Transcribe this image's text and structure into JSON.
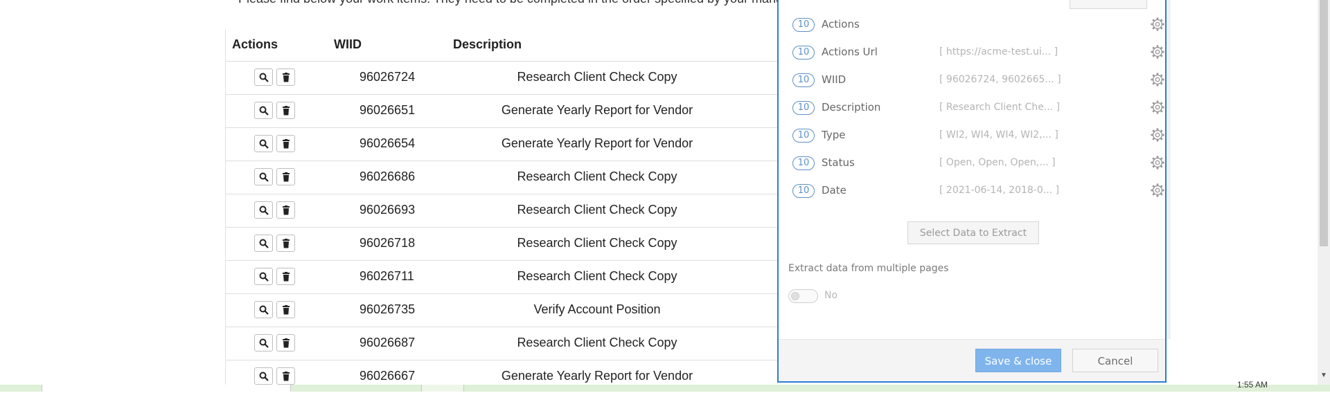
{
  "page": {
    "intro": "Please find below your work items. They need to be completed in the order specified by your manager.",
    "columns": {
      "actions": "Actions",
      "wiid": "WIID",
      "description": "Description"
    },
    "rows": [
      {
        "wiid": "96026724",
        "description": "Research Client Check Copy"
      },
      {
        "wiid": "96026651",
        "description": "Generate Yearly Report for Vendor"
      },
      {
        "wiid": "96026654",
        "description": "Generate Yearly Report for Vendor"
      },
      {
        "wiid": "96026686",
        "description": "Research Client Check Copy"
      },
      {
        "wiid": "96026693",
        "description": "Research Client Check Copy"
      },
      {
        "wiid": "96026718",
        "description": "Research Client Check Copy"
      },
      {
        "wiid": "96026711",
        "description": "Research Client Check Copy"
      },
      {
        "wiid": "96026735",
        "description": "Verify Account Position"
      },
      {
        "wiid": "96026687",
        "description": "Research Client Check Copy"
      },
      {
        "wiid": "96026667",
        "description": "Generate Yearly Report for Vendor"
      }
    ]
  },
  "dialog": {
    "fields": [
      {
        "count": "10",
        "name": "Actions",
        "preview": ""
      },
      {
        "count": "10",
        "name": "Actions Url",
        "preview": "[ https://acme-test.ui... ]"
      },
      {
        "count": "10",
        "name": "WIID",
        "preview": "[ 96026724, 9602665... ]"
      },
      {
        "count": "10",
        "name": "Description",
        "preview": "[ Research Client Che... ]"
      },
      {
        "count": "10",
        "name": "Type",
        "preview": "[ WI2, WI4, WI4, WI2,... ]"
      },
      {
        "count": "10",
        "name": "Status",
        "preview": "[ Open, Open, Open,... ]"
      },
      {
        "count": "10",
        "name": "Date",
        "preview": "[ 2021-06-14, 2018-0... ]"
      }
    ],
    "select_data_label": "Select Data to Extract",
    "multi_pages_label": "Extract data from multiple pages",
    "toggle_value": "No",
    "save_label": "Save & close",
    "cancel_label": "Cancel"
  },
  "taskbar": {
    "clock": "1:55 AM"
  },
  "colors": {
    "accent": "#2b7cd3",
    "save_button": "#7fb5ec",
    "taskbar": "#dff0d8"
  }
}
